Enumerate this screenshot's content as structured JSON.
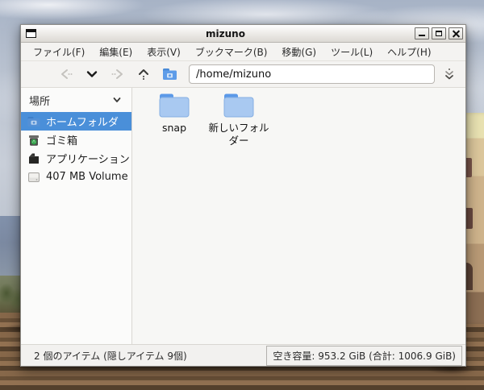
{
  "window": {
    "title": "mizuno",
    "controls": {
      "minimize": "minimize",
      "maximize": "maximize",
      "close": "close"
    }
  },
  "menu_bar": {
    "items": [
      "ファイル(F)",
      "編集(E)",
      "表示(V)",
      "ブックマーク(B)",
      "移動(G)",
      "ツール(L)",
      "ヘルプ(H)"
    ]
  },
  "toolbar": {
    "back_icon": "back-arrow",
    "history_icon": "chevron-down",
    "forward_icon": "forward-arrow",
    "up_icon": "up-arrow",
    "home_icon": "home-folder",
    "jump_icon": "jump-to-location",
    "path_value": "/home/mizuno"
  },
  "sidebar": {
    "header": "場所",
    "collapse_icon": "chevron-down",
    "items": [
      {
        "label": "ホームフォルダ",
        "icon": "home-folder-icon",
        "selected": true
      },
      {
        "label": "ゴミ箱",
        "icon": "trash-icon",
        "selected": false
      },
      {
        "label": "アプリケーション",
        "icon": "applications-icon",
        "selected": false
      },
      {
        "label": "407 MB Volume",
        "icon": "drive-icon",
        "selected": false
      }
    ]
  },
  "files": [
    {
      "name": "snap",
      "type": "folder"
    },
    {
      "name": "新しいフォルダー",
      "type": "folder"
    }
  ],
  "status_bar": {
    "items_text": "2 個のアイテム (隠しアイテム 9個)",
    "free_space_text": "空き容量: 953.2 GiB (合計: 1006.9 GiB)"
  },
  "colors": {
    "selection_blue": "#4a8fd9",
    "folder_body": "#a9c9f1",
    "folder_tab": "#5b99e8",
    "window_chrome": "#f2f1ef",
    "main_bg": "#f7f7f5",
    "trash_green": "#33a54a"
  }
}
